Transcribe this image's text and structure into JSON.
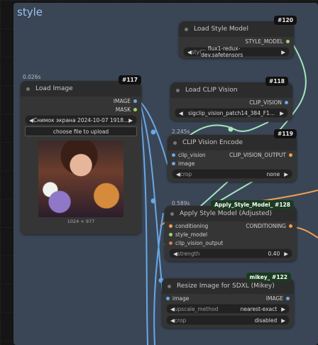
{
  "group": {
    "title": "style"
  },
  "colors": {
    "wire_blue": "#6aa8e6",
    "wire_green": "#a5e6bb",
    "wire_orange": "#f0a050",
    "group_bg": "#3a4656"
  },
  "nodes": {
    "style_model": {
      "badge": "#120",
      "title": "Load Style Model",
      "output": "STYLE_MODEL",
      "widget": {
        "label": "styl",
        "value": "... flux1-redux-dev.safetensors"
      }
    },
    "clip_vision": {
      "badge": "#118",
      "title": "Load CLIP Vision",
      "output": "CLIP_VISION",
      "widget": {
        "value": "sigclip_vision_patch14_384_F1..."
      }
    },
    "load_image": {
      "badge": "#117",
      "time": "0.026s",
      "title": "Load Image",
      "outputs": [
        "IMAGE",
        "MASK"
      ],
      "file": "Снимок экрана 2024-10-07 1918...",
      "upload_button": "choose file to upload",
      "dims": "1024 × 977"
    },
    "clip_encode": {
      "badge": "#119",
      "time": "2.245s",
      "title": "CLIP Vision Encode",
      "inputs": [
        "clip_vision",
        "image"
      ],
      "output": "CLIP_VISION_OUTPUT",
      "widget": {
        "label": "crop",
        "value": "none"
      }
    },
    "apply_style": {
      "badge_name": "Apply_Style_Model_",
      "badge": "#128",
      "time": "0.589s",
      "title": "Apply Style Model (Adjusted)",
      "inputs": [
        "conditioning",
        "style_model",
        "clip_vision_output"
      ],
      "output": "CONDITIONING",
      "widget": {
        "label": "strength",
        "value": "0.40"
      }
    },
    "resize": {
      "badge_name": "mikey_",
      "badge": "#122",
      "title": "Resize Image for SDXL (Mikey)",
      "input": "image",
      "output": "IMAGE",
      "widgets": [
        {
          "label": "upscale_method",
          "value": "nearest-exact"
        },
        {
          "label": "crop",
          "value": "disabled"
        }
      ]
    }
  }
}
